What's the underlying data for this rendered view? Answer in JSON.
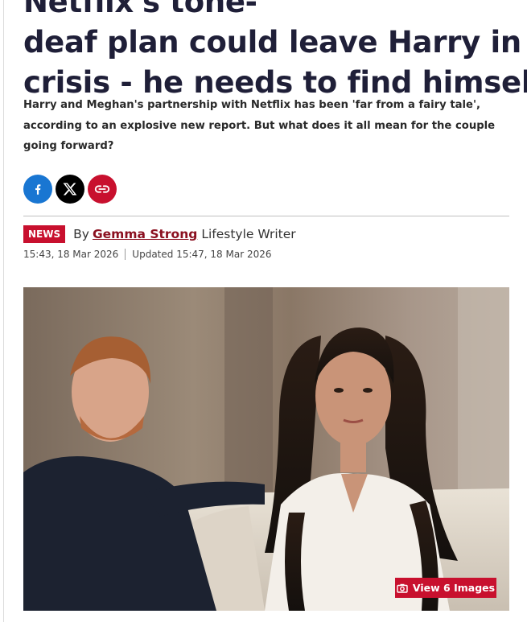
{
  "article": {
    "headline_lines": [
      "Netflix's tone-",
      "deaf plan could leave Harry in",
      "crisis - he needs to find himself'"
    ],
    "standfirst": "Harry and Meghan's partnership with Netflix has been 'far from a fairy tale', according to an explosive new report. But what does it all mean for the couple going forward?",
    "category_badge": "NEWS",
    "by_prefix": "By",
    "author_name": "Gemma Strong",
    "author_role": "Lifestyle Writer",
    "published": "15:43, 18 Mar 2026",
    "updated": "Updated 15:47, 18 Mar 2026"
  },
  "share": {
    "buttons": [
      {
        "icon": "facebook-icon",
        "color": "#1976d2"
      },
      {
        "icon": "x-icon",
        "color": "#000000"
      },
      {
        "icon": "link-icon",
        "color": "#c8102e"
      }
    ]
  },
  "gallery": {
    "label": "View 6 Images",
    "icon": "camera-icon"
  },
  "colors": {
    "brand_red": "#c8102e",
    "headline": "#1f1f38",
    "author": "#8b1020"
  }
}
